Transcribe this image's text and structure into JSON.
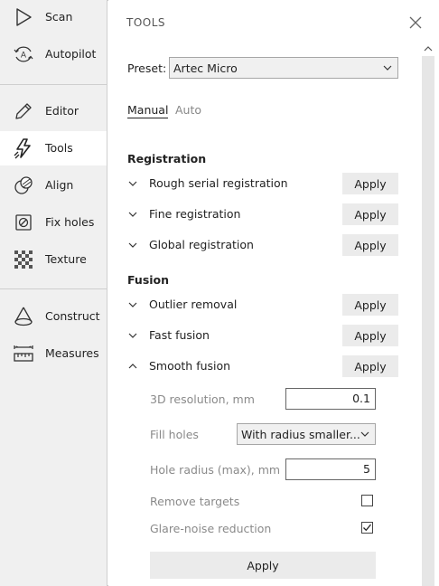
{
  "sidebar": {
    "items": [
      {
        "label": "Scan",
        "icon": "play-triangle-icon"
      },
      {
        "label": "Autopilot",
        "icon": "autopilot-icon"
      },
      {
        "label": "Editor",
        "icon": "pencil-icon"
      },
      {
        "label": "Tools",
        "icon": "lightning-icon"
      },
      {
        "label": "Align",
        "icon": "align-icon"
      },
      {
        "label": "Fix holes",
        "icon": "fix-holes-icon"
      },
      {
        "label": "Texture",
        "icon": "texture-checker-icon"
      },
      {
        "label": "Construct",
        "icon": "cone-icon"
      },
      {
        "label": "Measures",
        "icon": "ruler-icon"
      }
    ],
    "active": "Tools"
  },
  "panel": {
    "title": "TOOLS",
    "preset_label": "Preset:",
    "preset_value": "Artec Micro",
    "tabs": [
      {
        "label": "Manual",
        "active": true
      },
      {
        "label": "Auto",
        "active": false
      }
    ],
    "apply_label": "Apply",
    "sections": [
      {
        "title": "Registration",
        "items": [
          "Rough serial registration",
          "Fine registration",
          "Global registration"
        ]
      },
      {
        "title": "Fusion",
        "items": [
          "Outlier removal",
          "Fast fusion",
          "Smooth fusion"
        ]
      }
    ],
    "smooth_fusion": {
      "resolution_label": "3D resolution, mm",
      "resolution_value": "0.1",
      "fill_holes_label": "Fill holes",
      "fill_holes_value": "With radius smaller...",
      "hole_radius_label": "Hole radius (max), mm",
      "hole_radius_value": "5",
      "remove_targets_label": "Remove targets",
      "remove_targets_checked": false,
      "glare_label": "Glare-noise reduction",
      "glare_checked": true,
      "apply_label": "Apply"
    }
  },
  "colors": {
    "sidebar_bg": "#f0f0f0",
    "button_bg": "#ebebeb",
    "muted_text": "#8a8a8a",
    "scrollbar": "#e6e6e6"
  }
}
